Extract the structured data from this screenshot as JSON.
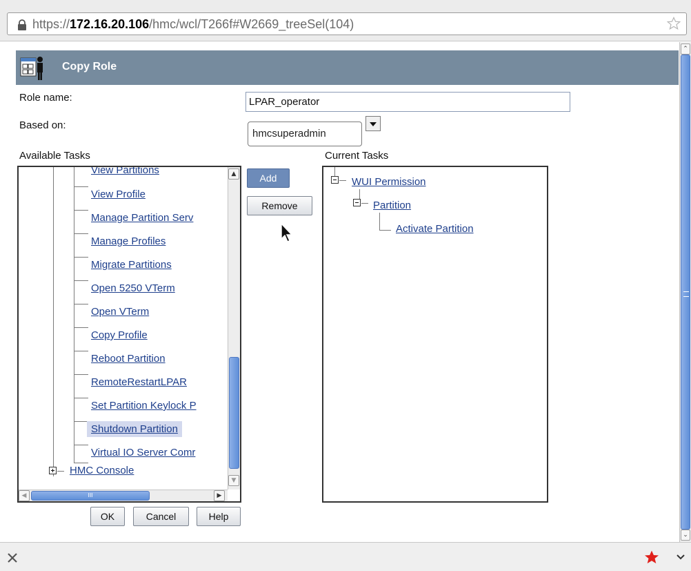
{
  "browser": {
    "url_prefix": "https://",
    "url_host": "172.16.20.106",
    "url_path": "/hmc/wcl/T266f#W2669_treeSel(104)"
  },
  "dialog": {
    "title": "Copy Role",
    "role_name_label": "Role name:",
    "role_name_value": "LPAR_operator",
    "based_on_label": "Based on:",
    "based_on_value": "hmcsuperadmin",
    "available_tasks_label": "Available Tasks",
    "current_tasks_label": "Current Tasks",
    "buttons": {
      "add": "Add",
      "remove": "Remove",
      "ok": "OK",
      "cancel": "Cancel",
      "help": "Help"
    }
  },
  "available_tasks": {
    "items": [
      "View Partitions",
      "View Profile",
      "Manage Partition Serv",
      "Manage Profiles",
      "Migrate Partitions",
      "Open 5250 VTerm",
      "Open VTerm",
      "Copy Profile",
      "Reboot Partition",
      "RemoteRestartLPAR",
      "Set Partition Keylock P",
      "Shutdown Partition",
      "Virtual IO Server Comr"
    ],
    "selected": "Shutdown Partition",
    "group": "HMC Console",
    "hscroll_grip": "III"
  },
  "current_tasks": {
    "root": "WUI Permission",
    "child": "Partition",
    "leaf": "Activate Partition"
  },
  "colors": {
    "header_bg": "#768b9e",
    "link": "#1e3f8c",
    "selection": "#d3d9ee",
    "scroll_thumb": "#5f8fd8",
    "add_button": "#6d8bb9"
  }
}
